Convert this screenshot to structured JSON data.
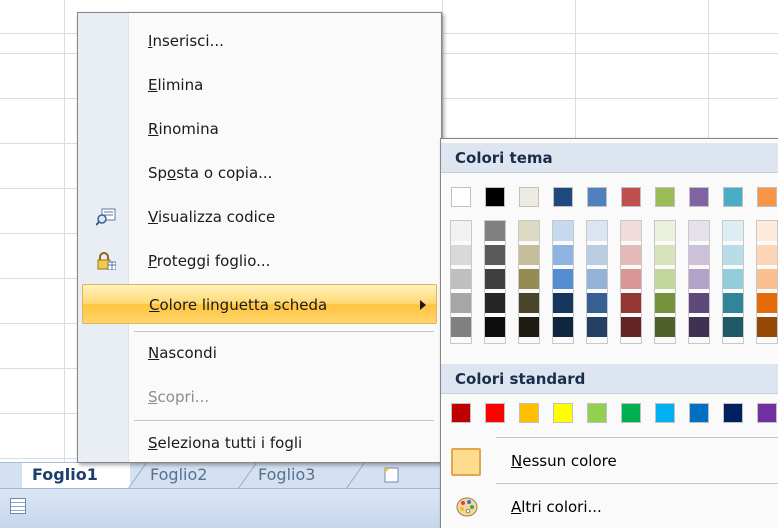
{
  "context_menu": {
    "items": [
      {
        "label": "Inserisci...",
        "accel": "I",
        "enabled": true
      },
      {
        "label": "Elimina",
        "accel": "E",
        "enabled": true
      },
      {
        "label": "Rinomina",
        "accel": "R",
        "enabled": true
      },
      {
        "label": "Sposta o copia...",
        "accel": "o",
        "enabled": true
      },
      {
        "label": "Visualizza codice",
        "accel": "V",
        "enabled": true,
        "icon": "view-code-icon"
      },
      {
        "label": "Proteggi foglio...",
        "accel": "P",
        "enabled": true,
        "icon": "protect-sheet-icon"
      },
      {
        "label": "Colore linguetta scheda",
        "accel": "C",
        "enabled": true,
        "submenu": true,
        "highlighted": true
      },
      {
        "label": "Nascondi",
        "accel": "N",
        "enabled": true
      },
      {
        "label": "Scopri...",
        "accel": "S",
        "enabled": false
      },
      {
        "label": "Seleziona tutti i fogli",
        "accel": "S",
        "enabled": true
      }
    ]
  },
  "color_submenu": {
    "theme_header": "Colori tema",
    "standard_header": "Colori standard",
    "theme_colors": [
      "#ffffff",
      "#000000",
      "#eeece1",
      "#1f497d",
      "#4f81bd",
      "#c0504d",
      "#9bbb59",
      "#8064a2",
      "#4bacc6",
      "#f79646"
    ],
    "theme_shades": [
      [
        "#f2f2f2",
        "#d9d9d9",
        "#bfbfbf",
        "#a6a6a6",
        "#808080"
      ],
      [
        "#808080",
        "#595959",
        "#404040",
        "#262626",
        "#0d0d0d"
      ],
      [
        "#ddd9c3",
        "#c4bd97",
        "#948a54",
        "#4a452a",
        "#1e1c11"
      ],
      [
        "#c6d9f0",
        "#8db3e2",
        "#548dd4",
        "#17365d",
        "#0f243e"
      ],
      [
        "#dbe5f1",
        "#b8cce4",
        "#95b3d7",
        "#366092",
        "#244061"
      ],
      [
        "#f2dcdb",
        "#e5b9b7",
        "#d99694",
        "#953734",
        "#632423"
      ],
      [
        "#ebf1dd",
        "#d7e3bc",
        "#c3d69b",
        "#76923c",
        "#4f6128"
      ],
      [
        "#e5e0ec",
        "#ccc1d9",
        "#b2a2c7",
        "#5f497a",
        "#3f3151"
      ],
      [
        "#dbeef3",
        "#b7dde8",
        "#92cddc",
        "#31859b",
        "#205867"
      ],
      [
        "#fdeada",
        "#fbd5b5",
        "#fac08f",
        "#e36c09",
        "#974806"
      ]
    ],
    "standard_colors": [
      "#c00000",
      "#ff0000",
      "#ffc000",
      "#ffff00",
      "#92d050",
      "#00b050",
      "#00b0f0",
      "#0070c0",
      "#002060",
      "#7030a0"
    ],
    "no_color_label": "Nessun colore",
    "no_color_accel": "N",
    "more_colors_label": "Altri colori...",
    "more_colors_accel": "A"
  },
  "sheet_tabs": [
    {
      "label": "Foglio1",
      "active": true
    },
    {
      "label": "Foglio2",
      "active": false
    },
    {
      "label": "Foglio3",
      "active": false
    }
  ]
}
